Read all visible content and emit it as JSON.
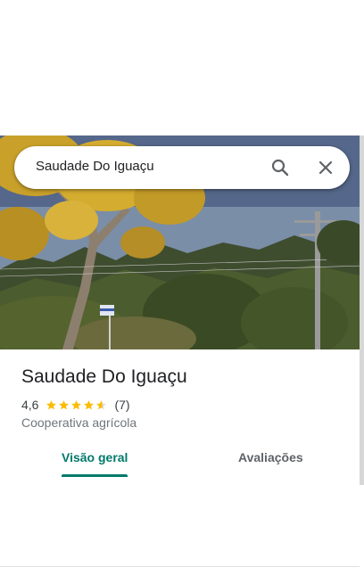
{
  "search": {
    "query": "Saudade Do Iguaçu"
  },
  "icons": {
    "search": "search-icon",
    "close": "close-icon",
    "star": "star-icon"
  },
  "place": {
    "name": "Saudade Do Iguaçu",
    "rating": "4,6",
    "rating_value": 4.6,
    "review_count": "(7)",
    "category": "Cooperativa agrícola"
  },
  "tabs": [
    {
      "label": "Visão geral",
      "selected": true
    },
    {
      "label": "Avaliações",
      "selected": false
    }
  ],
  "colors": {
    "accent": "#00796b",
    "star": "#fbbc04",
    "star_empty": "#dadce0",
    "text": "#202124",
    "secondary_text": "#70757a"
  }
}
